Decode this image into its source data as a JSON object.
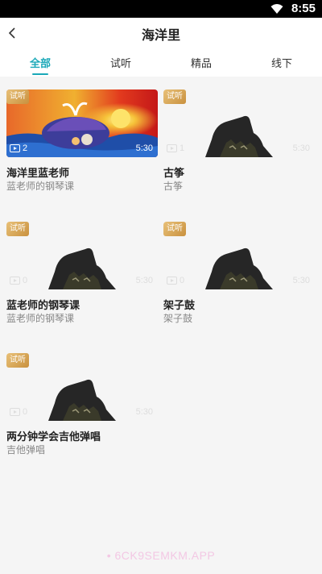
{
  "status": {
    "time": "8:55"
  },
  "nav": {
    "title": "海洋里"
  },
  "tabs": [
    {
      "label": "全部",
      "active": true
    },
    {
      "label": "试听",
      "active": false
    },
    {
      "label": "精品",
      "active": false
    },
    {
      "label": "线下",
      "active": false
    }
  ],
  "courses": [
    {
      "title": "海洋里蓝老师",
      "subtitle": "蓝老师的钢琴课",
      "badge": "试听",
      "count": "2",
      "duration": "5:30"
    },
    {
      "title": "古筝",
      "subtitle": "古筝",
      "badge": "试听",
      "count": "1",
      "duration": "5:30"
    },
    {
      "title": "蓝老师的钢琴课",
      "subtitle": "蓝老师的钢琴课",
      "badge": "试听",
      "count": "0",
      "duration": "5:30"
    },
    {
      "title": "架子鼓",
      "subtitle": "架子鼓",
      "badge": "试听",
      "count": "0",
      "duration": "5:30"
    },
    {
      "title": "两分钟学会吉他弹唱",
      "subtitle": "吉他弹唱",
      "badge": "试听",
      "count": "0",
      "duration": "5:30"
    }
  ],
  "watermark": "• 6CK9SEMKM.APP"
}
